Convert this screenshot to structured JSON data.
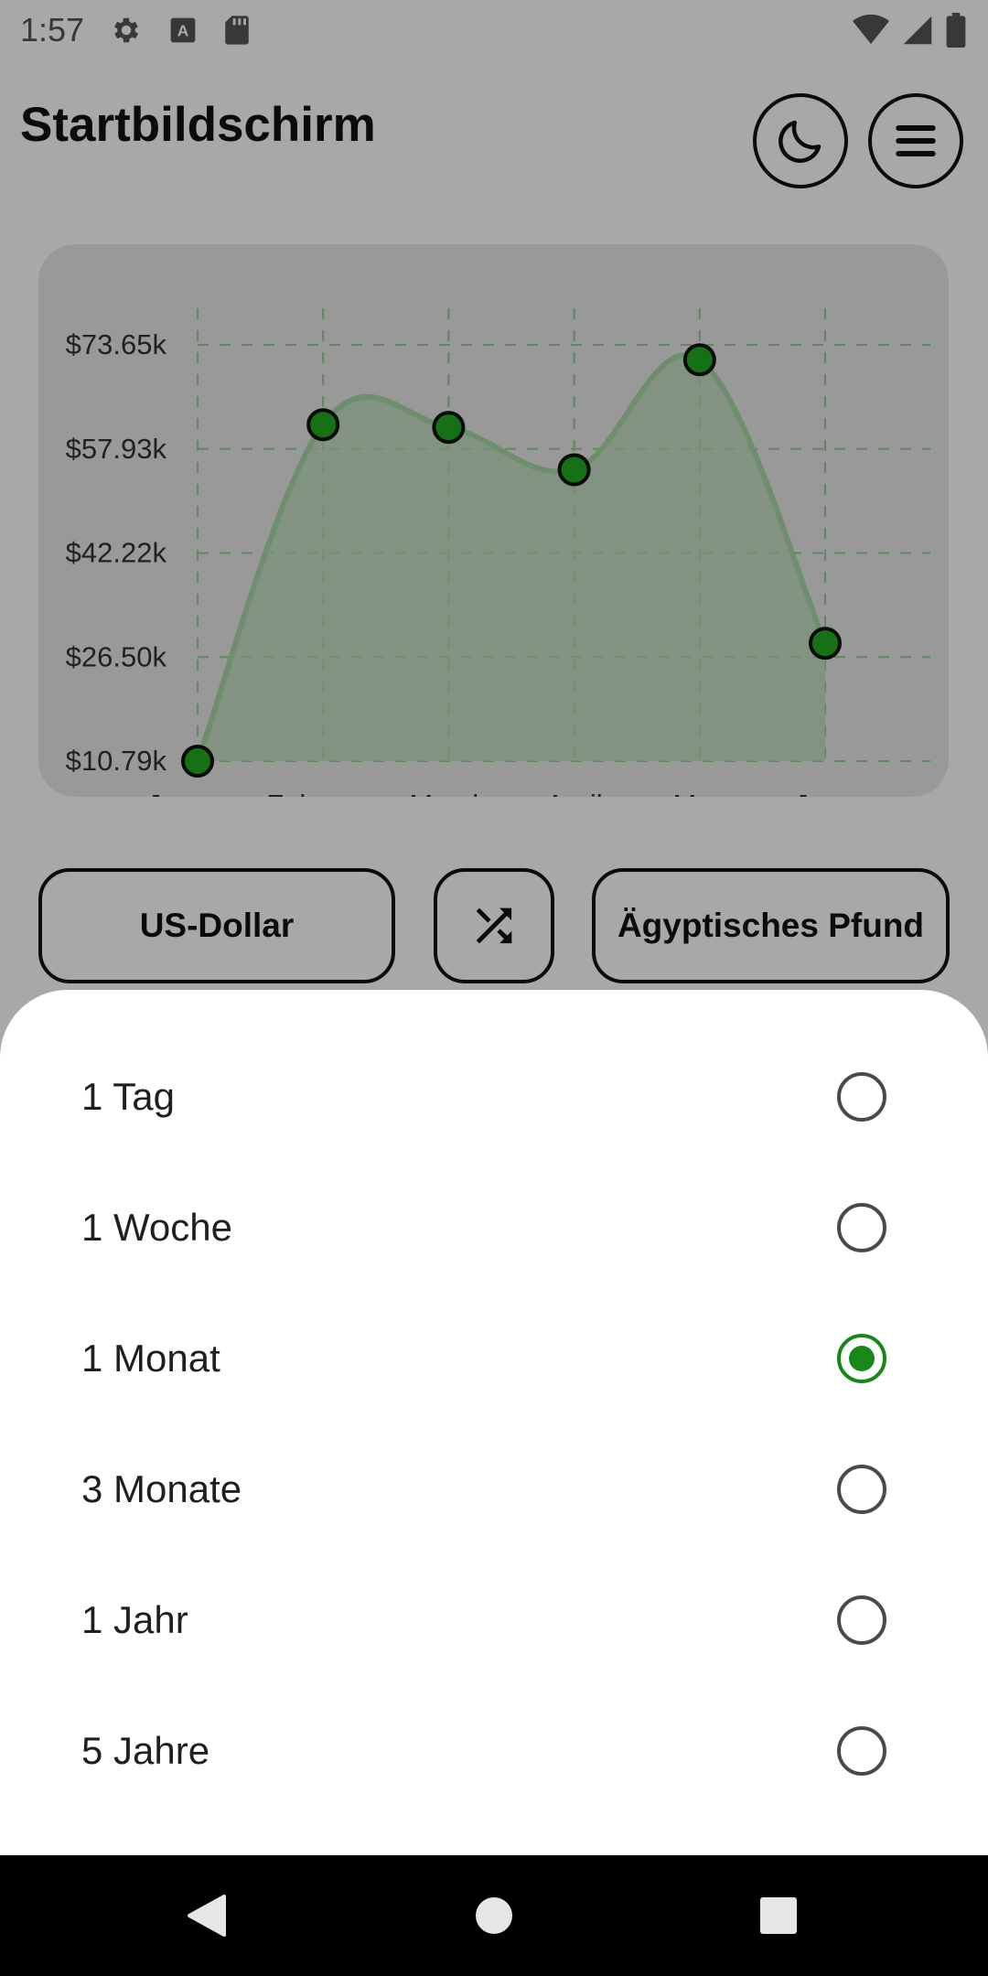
{
  "status_bar": {
    "time": "1:57",
    "left_icons": [
      "gear-icon",
      "a-text-icon",
      "sd-card-icon"
    ],
    "right_icons": [
      "wifi-icon",
      "signal-icon",
      "battery-icon"
    ]
  },
  "app_bar": {
    "title": "Startbildschirm",
    "theme_button_icon": "moon-icon",
    "menu_button_icon": "hamburger-menu-icon"
  },
  "chart_data": {
    "type": "area",
    "categories": [
      "January",
      "February",
      "March",
      "April",
      "May",
      "June"
    ],
    "values": [
      10790,
      61600,
      61200,
      54800,
      71400,
      28600
    ],
    "y_tick_labels": [
      "$73.65k",
      "$57.93k",
      "$42.22k",
      "$26.50k",
      "$10.79k"
    ],
    "y_ticks": [
      73650,
      57930,
      42220,
      26500,
      10790
    ],
    "ylim": [
      10790,
      73650
    ],
    "grid": true,
    "line_color": "#22aa22",
    "marker_color": "#22aa22",
    "title": "",
    "xlabel": "",
    "ylabel": ""
  },
  "currency": {
    "from_label": "US-Dollar",
    "swap_icon": "shuffle-icon",
    "to_label": "Ägyptisches Pfund"
  },
  "period_sheet": {
    "options": [
      {
        "label": "1 Tag",
        "selected": false
      },
      {
        "label": "1 Woche",
        "selected": false
      },
      {
        "label": "1 Monat",
        "selected": true
      },
      {
        "label": "3 Monate",
        "selected": false
      },
      {
        "label": "1 Jahr",
        "selected": false
      },
      {
        "label": "5 Jahre",
        "selected": false
      }
    ],
    "accent_color": "#17871a"
  },
  "nav_bar": {
    "back_icon": "back-triangle-icon",
    "home_icon": "home-circle-icon",
    "recents_icon": "recents-square-icon"
  }
}
